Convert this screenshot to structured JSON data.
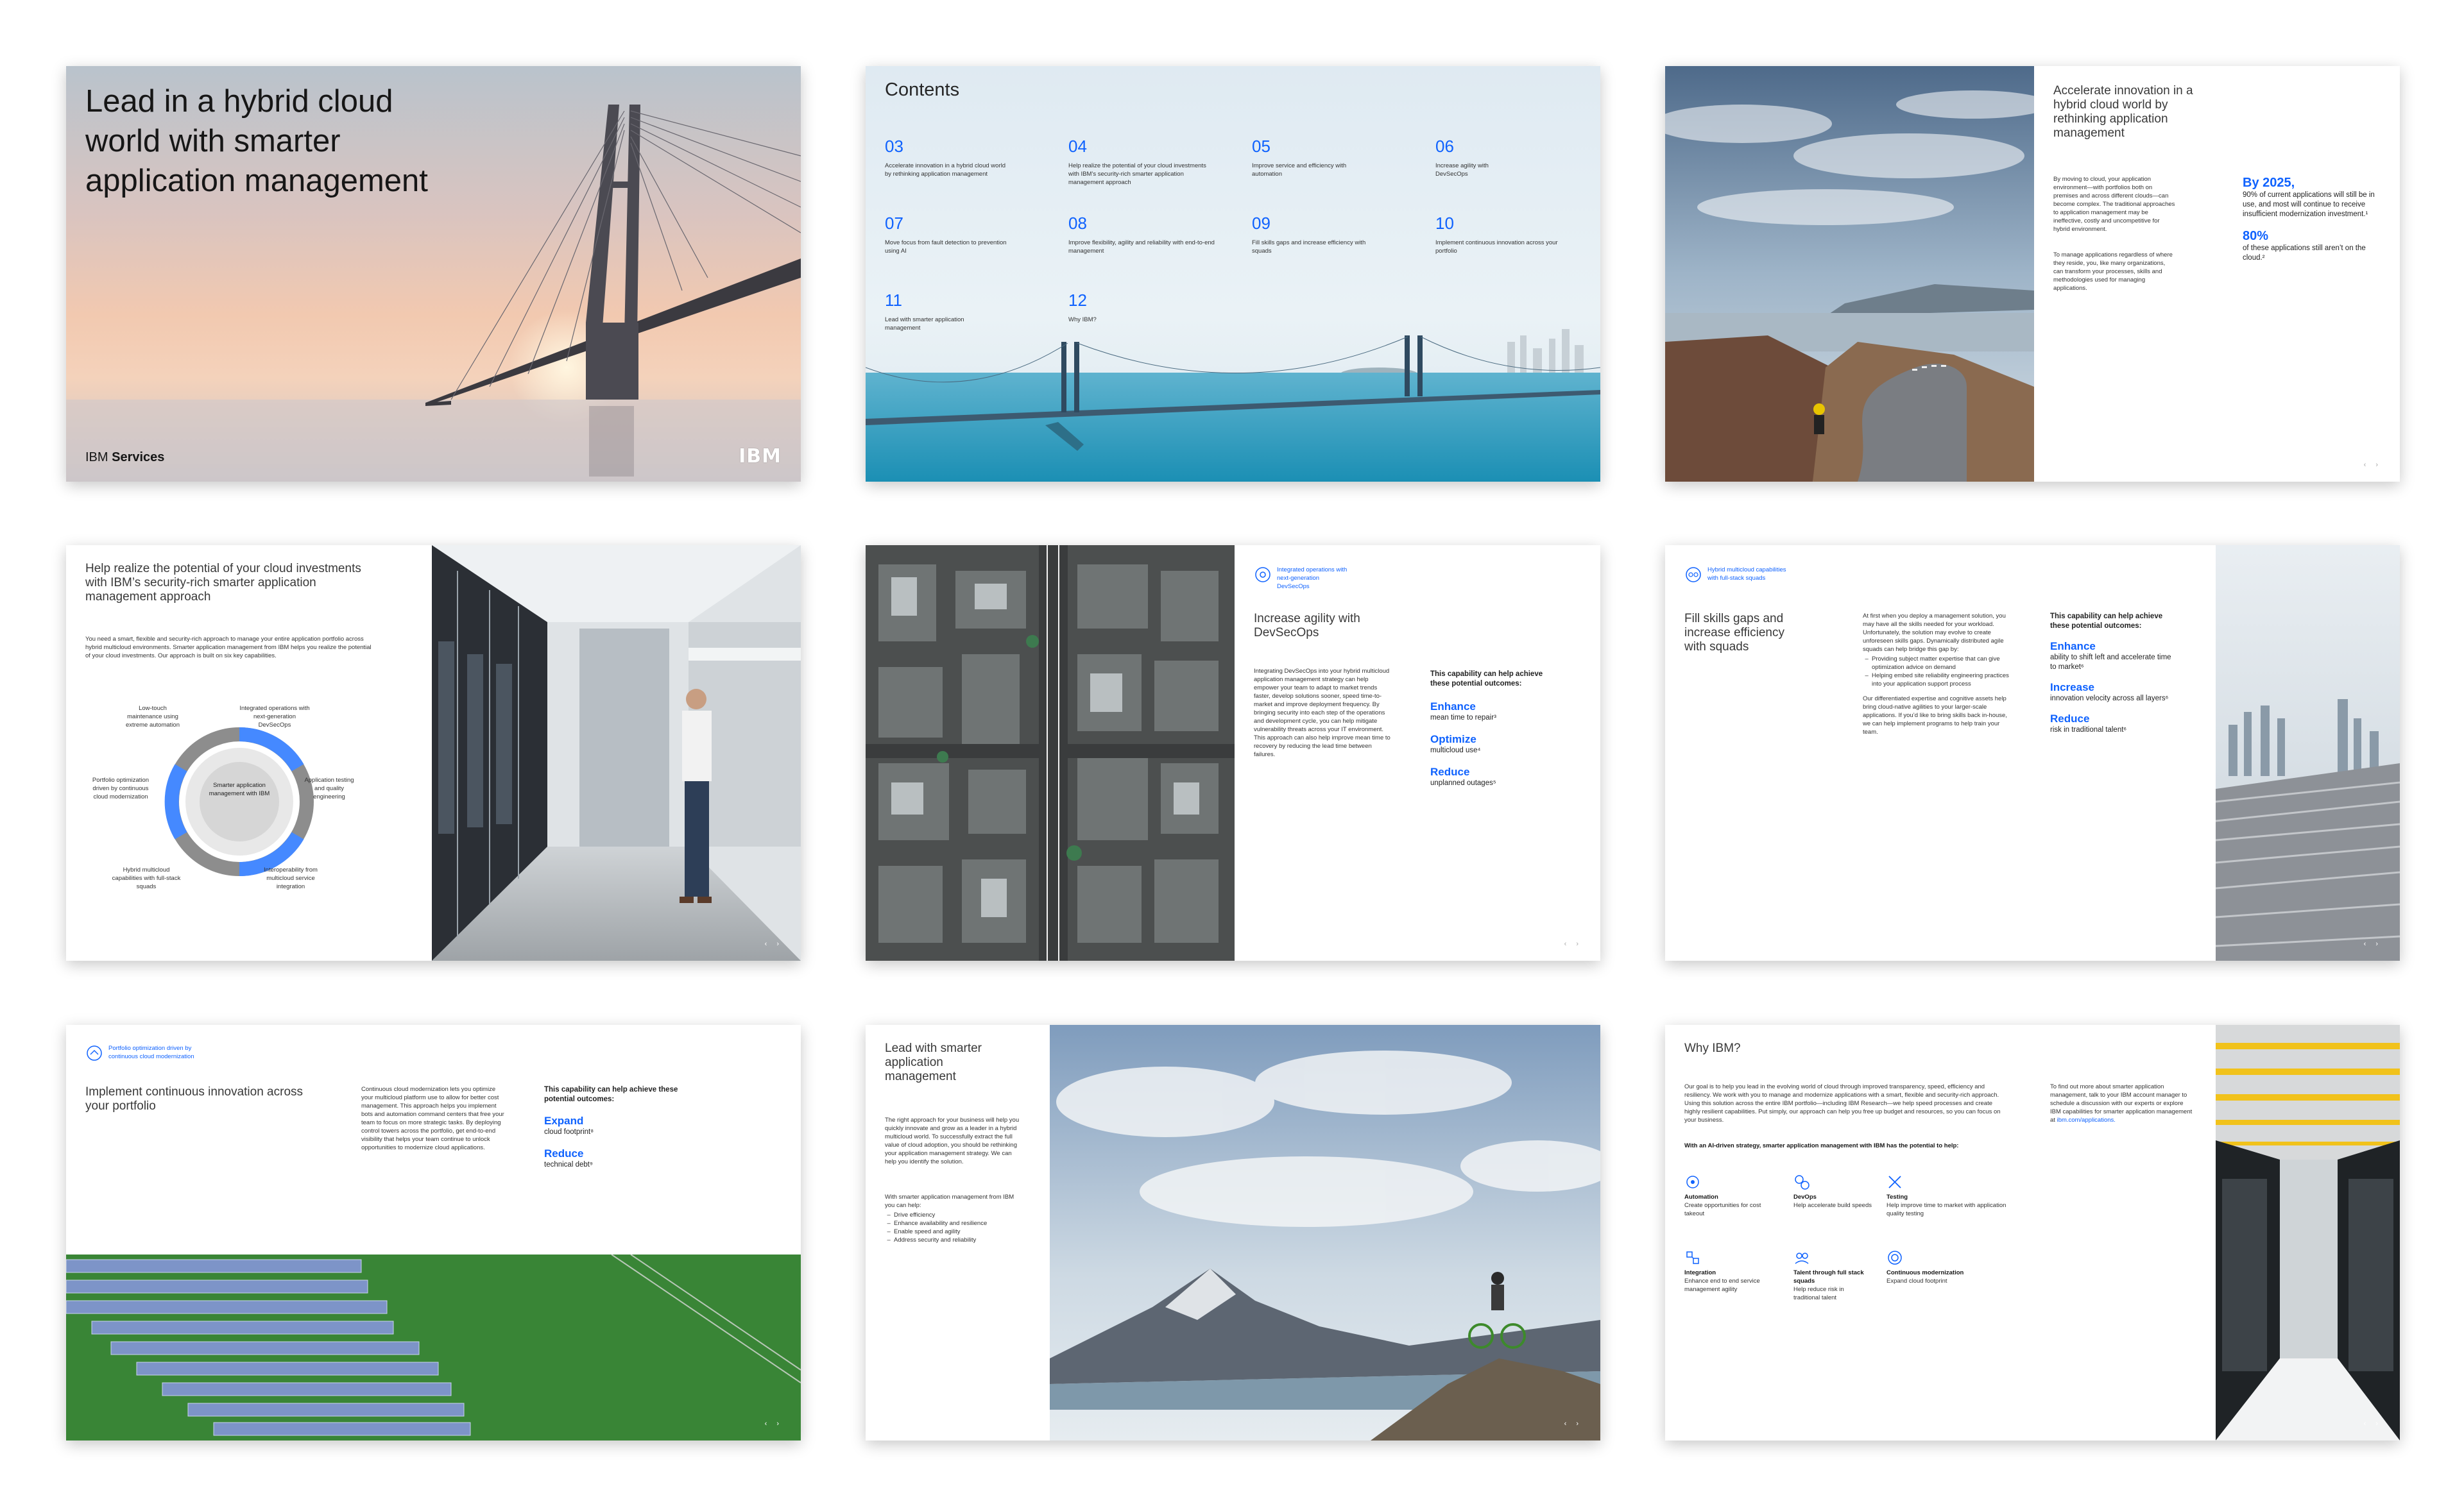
{
  "s1": {
    "title_lines": [
      "Lead in a hybrid cloud",
      "world with smarter",
      "application management"
    ],
    "brand_light": "IBM",
    "brand_bold": "Services",
    "logo": "IBM"
  },
  "s2": {
    "heading": "Contents",
    "items": [
      {
        "num": "03",
        "text": "Accelerate innovation in a hybrid cloud world by rethinking application management"
      },
      {
        "num": "04",
        "text": "Help realize the potential of your cloud investments with IBM’s security-rich smarter application management approach"
      },
      {
        "num": "05",
        "text": "Improve service and efficiency with automation"
      },
      {
        "num": "06",
        "text": "Increase agility with DevSecOps"
      },
      {
        "num": "07",
        "text": "Move focus from fault detection to prevention using AI"
      },
      {
        "num": "08",
        "text": "Improve flexibility, agility and reliability with end-to-end management"
      },
      {
        "num": "09",
        "text": "Fill skills gaps and increase efficiency with squads"
      },
      {
        "num": "10",
        "text": "Implement continuous innovation across your portfolio"
      },
      {
        "num": "11",
        "text": "Lead with smarter application management"
      },
      {
        "num": "12",
        "text": "Why IBM?"
      }
    ]
  },
  "s3": {
    "title": "Accelerate innovation in a hybrid cloud world by rethinking application management",
    "p1": "By moving to cloud, your application environment—with portfolios both on premises and across different clouds—can become complex. The traditional approaches to application management may be ineffective, costly and uncompetitive for hybrid environment.",
    "p2": "To manage applications regardless of where they reside, you, like many organizations, can transform your processes, skills and methodologies used for managing applications.",
    "stat1_head": "By 2025,",
    "stat1_text": "90% of current applications will still be in use, and most will continue to receive insufficient modernization investment.¹",
    "stat2_head": "80%",
    "stat2_text": "of these applications still aren’t on the cloud.²",
    "nav": "‹ ›"
  },
  "s4": {
    "title": "Help realize the potential of your cloud investments with IBM’s security-rich smarter application management approach",
    "intro": "You need a smart, flexible and security-rich approach to manage your entire application portfolio across hybrid multicloud environments. Smarter application management from IBM helps you realize the potential of your cloud investments. Our approach is built on six key capabilities.",
    "center": "Smarter application management with IBM",
    "labels": [
      "Integrated operations with next-generation DevSecOps",
      "Application testing and quality engineering",
      "Interoperability from multicloud service integration",
      "Hybrid multicloud capabilities with full-stack squads",
      "Portfolio optimization driven by continuous cloud modernization",
      "Low-touch maintenance using extreme automation"
    ],
    "nav": "‹ ›"
  },
  "s5": {
    "badge": "Integrated operations with next-generation DevSecOps",
    "title": "Increase agility with DevSecOps",
    "body": "Integrating DevSecOps into your hybrid multicloud application management strategy can help empower your team to adapt to market trends faster, develop solutions sooner, speed time-to-market and improve deployment frequency. By bringing security into each step of the operations and development cycle, you can help mitigate vulnerability threats across your IT environment. This approach can also help improve mean time to recovery by reducing the lead time between failures.",
    "cap": "This capability can help achieve these potential outcomes:",
    "outcomes": [
      {
        "head": "Enhance",
        "text": "mean time to repair³"
      },
      {
        "head": "Optimize",
        "text": "multicloud use⁴"
      },
      {
        "head": "Reduce",
        "text": "unplanned outages⁵"
      }
    ],
    "nav": "‹ ›"
  },
  "s6": {
    "badge": "Hybrid multicloud capabilities with full-stack squads",
    "title": "Fill skills gaps and increase efficiency with squads",
    "body1": "At first when you deploy a management solution, you may have all the skills needed for your workload. Unfortunately, the solution may evolve to create unforeseen skills gaps. Dynamically distributed agile squads can help bridge this gap by:",
    "bullets": [
      "Providing subject matter expertise that can give optimization advice on demand",
      "Helping embed site reliability engineering practices into your application support process"
    ],
    "body2": "Our differentiated expertise and cognitive assets help bring cloud-native agilities to your larger-scale applications. If you’d like to bring skills back in-house, we can help implement programs to help train your team.",
    "cap": "This capability can help achieve these potential outcomes:",
    "outcomes": [
      {
        "head": "Enhance",
        "text": "ability to shift left and accelerate time to market⁶"
      },
      {
        "head": "Increase",
        "text": "innovation velocity across all layers⁶"
      },
      {
        "head": "Reduce",
        "text": "risk in traditional talent⁶"
      }
    ],
    "nav": "‹ ›"
  },
  "s7": {
    "badge": "Portfolio optimization driven by continuous cloud modernization",
    "title": "Implement continuous innovation across your portfolio",
    "body": "Continuous cloud modernization lets you optimize your multicloud platform use to allow for better cost management. This approach helps you implement bots and automation command centers that free your team to focus on more strategic tasks. By deploying control towers across the portfolio, get end-to-end visibility that helps your team continue to unlock opportunities to modernize cloud applications.",
    "cap": "This capability can help achieve these potential outcomes:",
    "outcomes": [
      {
        "head": "Expand",
        "text": "cloud footprint⁸"
      },
      {
        "head": "Reduce",
        "text": "technical debt⁹"
      }
    ],
    "nav": "‹ ›"
  },
  "s8": {
    "title": "Lead with smarter application management",
    "p1": "The right approach for your business will help you quickly innovate and grow as a leader in a hybrid multicloud world. To successfully extract the full value of cloud adoption, you should be rethinking your application management strategy. We can help you identify the solution.",
    "p2": "With smarter application management from IBM you can help:",
    "bullets": [
      "Drive efficiency",
      "Enhance availability and resilience",
      "Enable speed and agility",
      "Address security and reliability"
    ],
    "nav": "‹ ›"
  },
  "s9": {
    "title": "Why IBM?",
    "p1": "Our goal is to help you lead in the evolving world of cloud through improved transparency, speed, efficiency and resiliency. We work with you to manage and modernize applications with a smart, flexible and security-rich approach. Using this solution across the entire IBM portfolio—including IBM Research—we help speed processes and create highly resilient capabilities. Put simply, our approach can help you free up budget and resources, so you can focus on your business.",
    "p2": "With an AI-driven strategy, smarter application management with IBM has the potential to help:",
    "side": "To find out more about smarter application management, talk to your IBM account manager to schedule a discussion with our experts or explore IBM capabilities for smarter application management at",
    "link": "ibm.com/applications.",
    "features": [
      {
        "head": "Automation",
        "text": "Create opportunities for cost takeout"
      },
      {
        "head": "DevOps",
        "text": "Help accelerate build speeds"
      },
      {
        "head": "Testing",
        "text": "Help improve time to market with application quality testing"
      },
      {
        "head": "Integration",
        "text": "Enhance end to end service management agility"
      },
      {
        "head": "Talent through full stack squads",
        "text": "Help reduce risk in traditional talent"
      },
      {
        "head": "Continuous modernization",
        "text": "Expand cloud footprint"
      }
    ],
    "nav": "‹ ›"
  },
  "colors": {
    "ibm_blue": "#0f62fe",
    "text": "#161616",
    "light_gray": "#a8a8a8"
  }
}
